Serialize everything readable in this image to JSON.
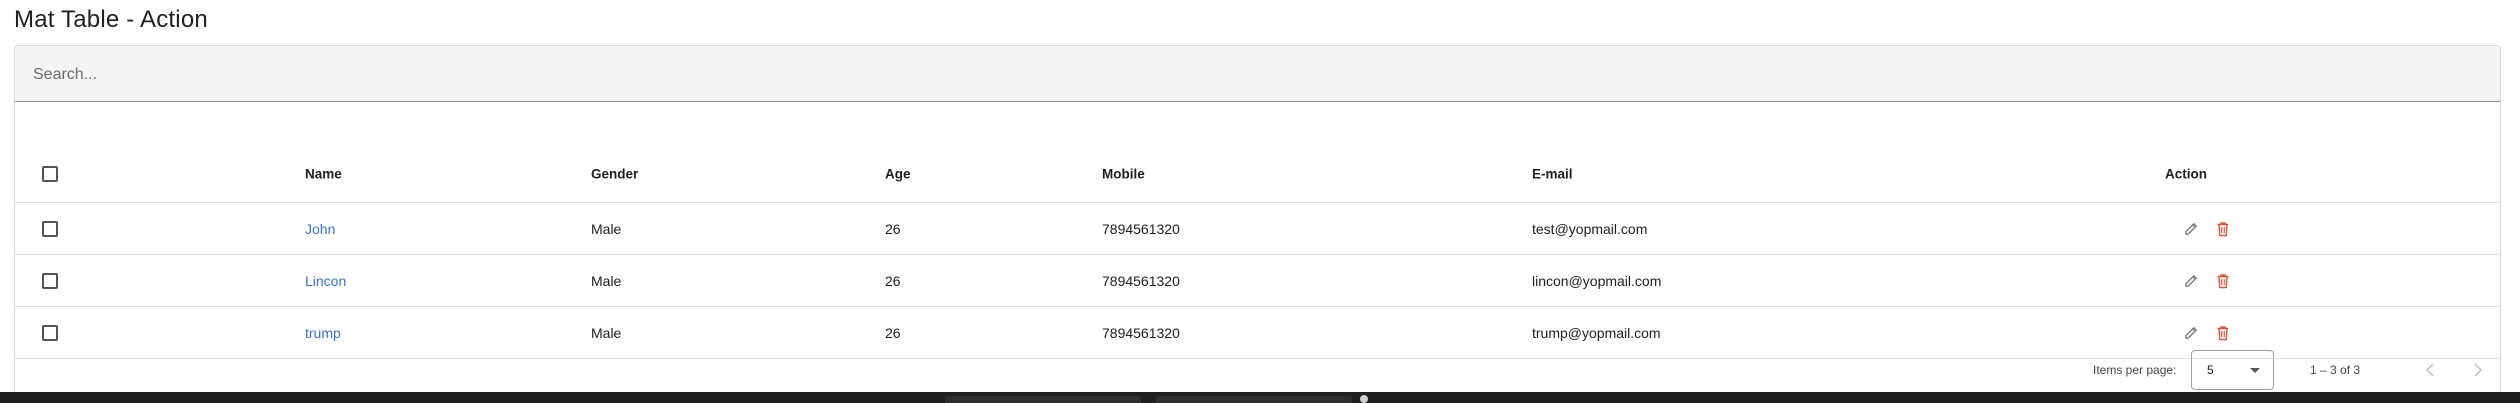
{
  "page": {
    "title": "Mat Table - Action"
  },
  "search": {
    "placeholder": "Search...",
    "value": ""
  },
  "table": {
    "columns": {
      "name": "Name",
      "gender": "Gender",
      "age": "Age",
      "mobile": "Mobile",
      "email": "E-mail",
      "action": "Action"
    },
    "rows": [
      {
        "name": "John",
        "gender": "Male",
        "age": "26",
        "mobile": "7894561320",
        "email": "test@yopmail.com"
      },
      {
        "name": "Lincon",
        "gender": "Male",
        "age": "26",
        "mobile": "7894561320",
        "email": "lincon@yopmail.com"
      },
      {
        "name": "trump",
        "gender": "Male",
        "age": "26",
        "mobile": "7894561320",
        "email": "trump@yopmail.com"
      }
    ]
  },
  "paginator": {
    "items_per_page_label": "Items per page:",
    "page_size": "5",
    "range_label": "1 – 3 of 3"
  },
  "colors": {
    "link": "#3b6fd1",
    "delete_icon": "#e0533f",
    "edit_icon": "#757575",
    "search_bg": "#f5f5f5"
  },
  "icons": {
    "edit": "pencil-icon",
    "delete": "trash-icon",
    "previous": "chevron-left-icon",
    "next": "chevron-right-icon",
    "dropdown": "caret-down-icon"
  }
}
